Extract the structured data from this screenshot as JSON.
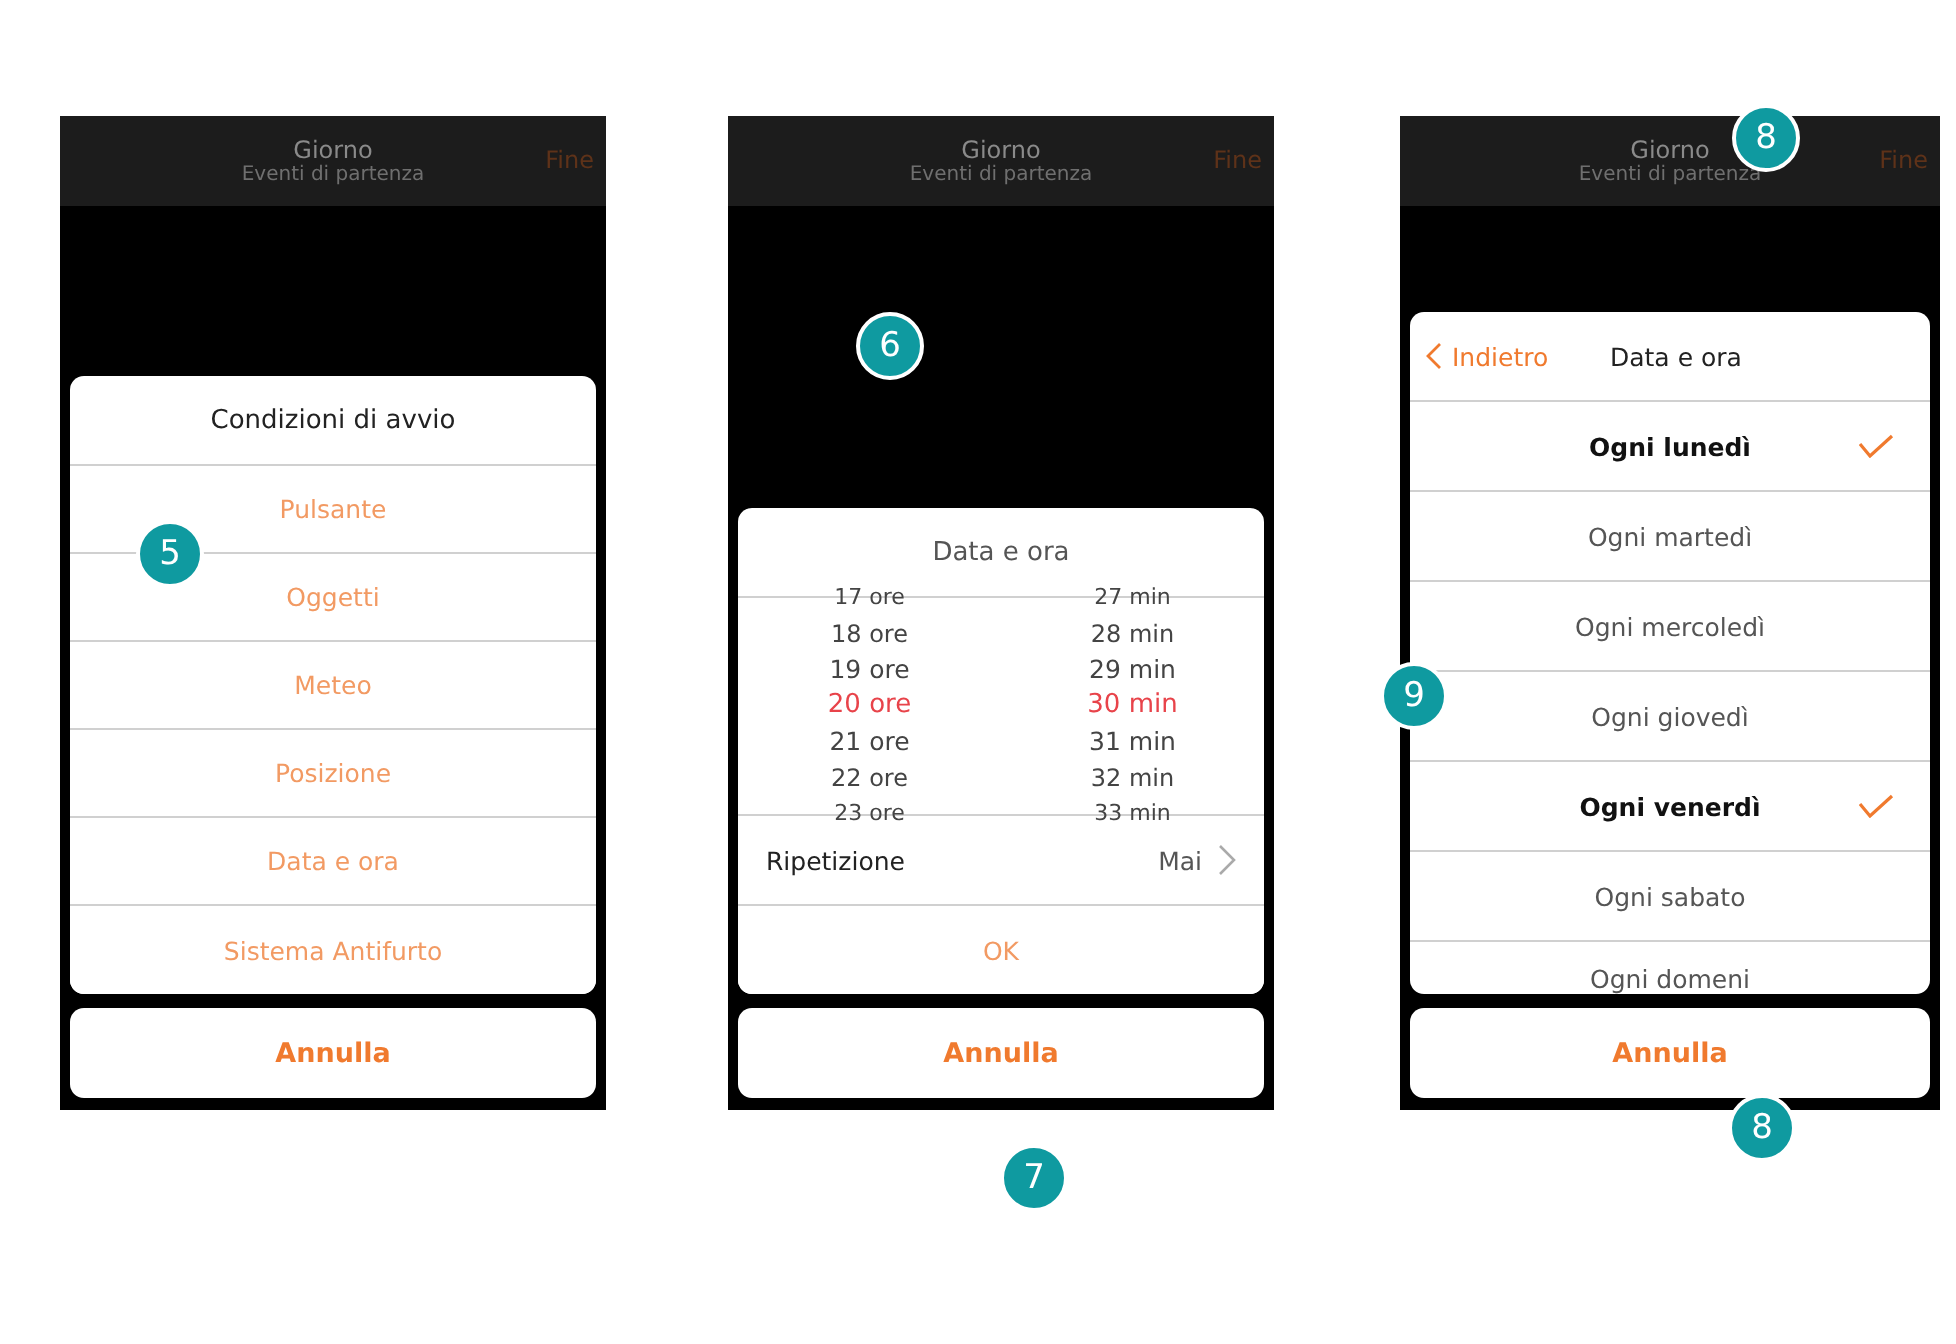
{
  "screens": [
    {
      "kind": "menu",
      "header": {
        "title": "Giorno",
        "subtitle": "Eventi di partenza",
        "action": "Fine"
      },
      "sheet_title": "Condizioni di avvio",
      "options": [
        "Pulsante",
        "Oggetti",
        "Meteo",
        "Posizione",
        "Data e ora",
        "Sistema Antifurto"
      ],
      "cancel": "Annulla"
    },
    {
      "kind": "picker",
      "header": {
        "title": "Giorno",
        "subtitle": "Eventi di partenza",
        "action": "Fine"
      },
      "sheet_title": "Data e ora",
      "hours": [
        {
          "label": "17 ore",
          "selected": false
        },
        {
          "label": "18 ore",
          "selected": false
        },
        {
          "label": "19 ore",
          "selected": false
        },
        {
          "label": "20 ore",
          "selected": true
        },
        {
          "label": "21 ore",
          "selected": false
        },
        {
          "label": "22 ore",
          "selected": false
        },
        {
          "label": "23 ore",
          "selected": false
        }
      ],
      "minutes": [
        {
          "label": "27 min",
          "selected": false
        },
        {
          "label": "28 min",
          "selected": false
        },
        {
          "label": "29 min",
          "selected": false
        },
        {
          "label": "30 min",
          "selected": true
        },
        {
          "label": "31 min",
          "selected": false
        },
        {
          "label": "32 min",
          "selected": false
        },
        {
          "label": "33 min",
          "selected": false
        }
      ],
      "repeat": {
        "label": "Ripetizione",
        "value": "Mai"
      },
      "ok": "OK",
      "cancel": "Annulla"
    },
    {
      "kind": "days",
      "header": {
        "title": "Giorno",
        "subtitle": "Eventi di partenza",
        "action": "Fine"
      },
      "back": "Indietro",
      "sheet_title": "Data e ora",
      "days": [
        {
          "label": "Ogni lunedì",
          "checked": true
        },
        {
          "label": "Ogni martedì",
          "checked": false
        },
        {
          "label": "Ogni mercoledì",
          "checked": false
        },
        {
          "label": "Ogni giovedì",
          "checked": false
        },
        {
          "label": "Ogni venerdì",
          "checked": true
        },
        {
          "label": "Ogni sabato",
          "checked": false
        },
        {
          "label": "Ogni domeni",
          "checked": false
        }
      ],
      "cancel": "Annulla"
    }
  ],
  "step_badges": [
    {
      "label": "5"
    },
    {
      "label": "6"
    },
    {
      "label": "7"
    },
    {
      "label": "8"
    },
    {
      "label": "9"
    },
    {
      "label": "8"
    }
  ]
}
